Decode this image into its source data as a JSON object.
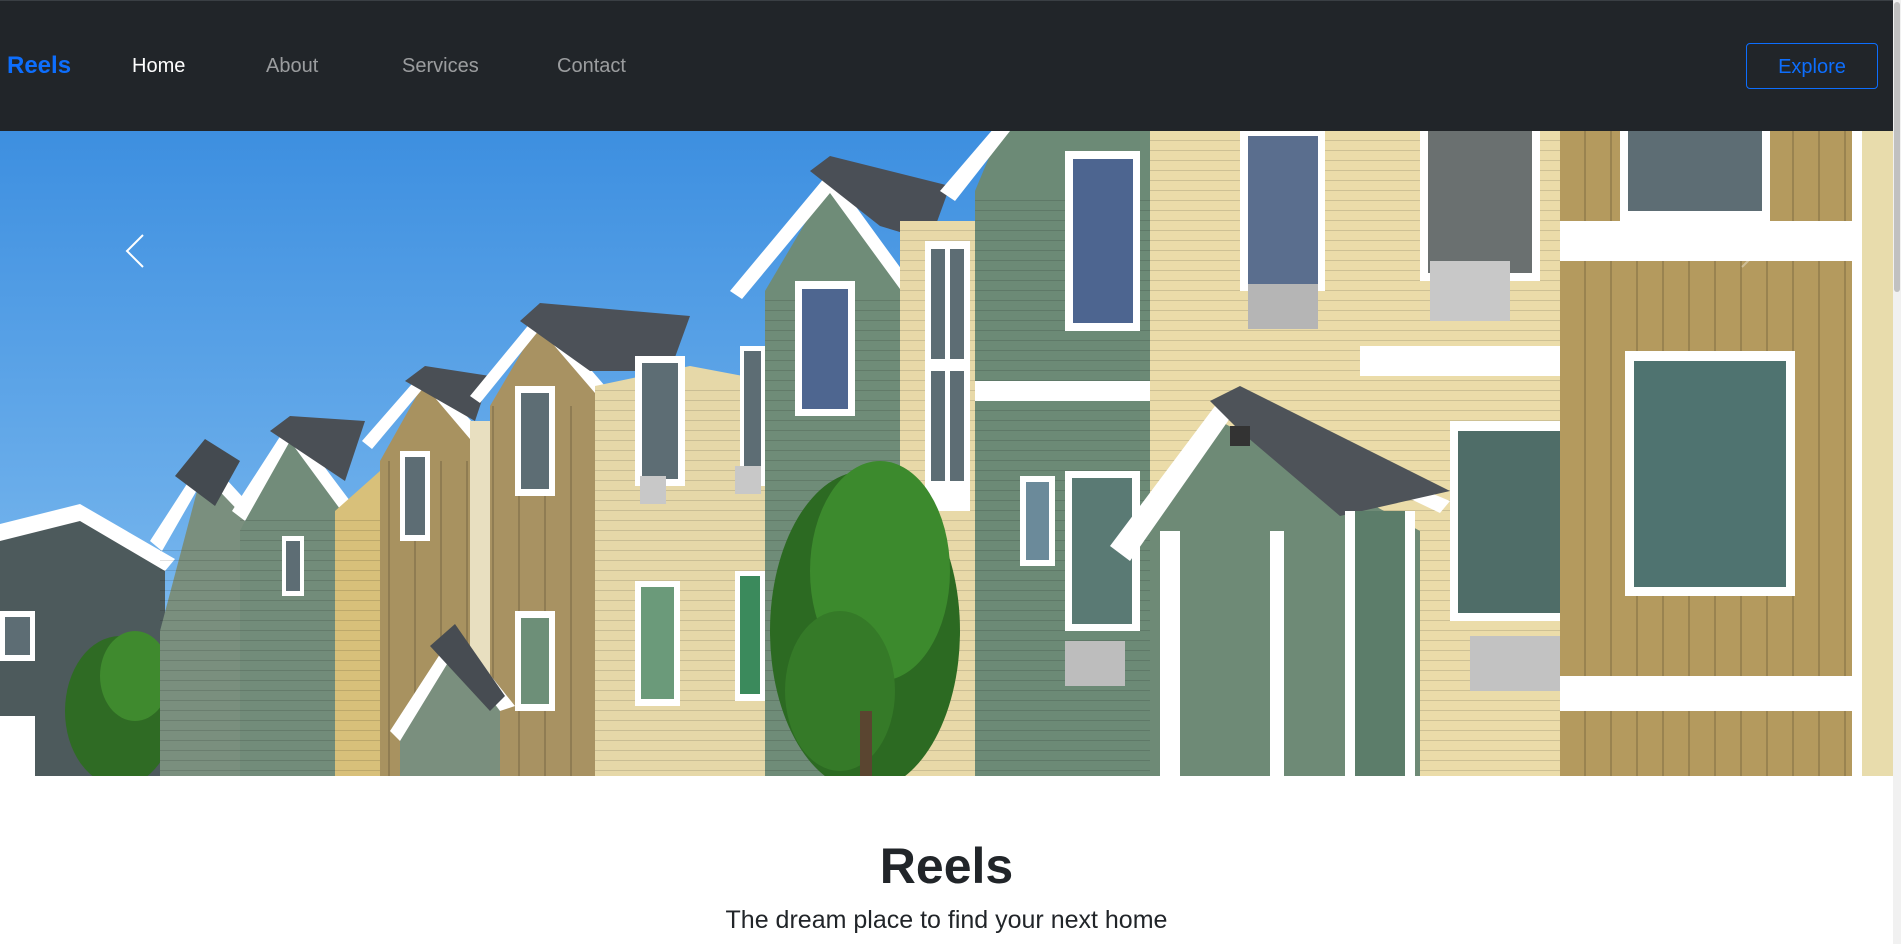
{
  "navbar": {
    "brand": "Reels",
    "links": [
      {
        "label": "Home",
        "active": true
      },
      {
        "label": "About",
        "active": false
      },
      {
        "label": "Services",
        "active": false
      },
      {
        "label": "Contact",
        "active": false
      }
    ],
    "cta_label": "Explore"
  },
  "carousel": {
    "prev_icon": "chevron-left-icon",
    "next_icon": "chevron-right-icon",
    "image_subject": "row-of-townhouses"
  },
  "intro": {
    "title": "Reels",
    "subtitle": "The dream place to find your next home"
  },
  "colors": {
    "navbar_bg": "#212529",
    "brand": "#0d6efd",
    "nav_link": "rgba(255,255,255,0.55)",
    "nav_link_active": "#ffffff",
    "sky": "#5aa6e6",
    "text_dark": "#212529"
  }
}
